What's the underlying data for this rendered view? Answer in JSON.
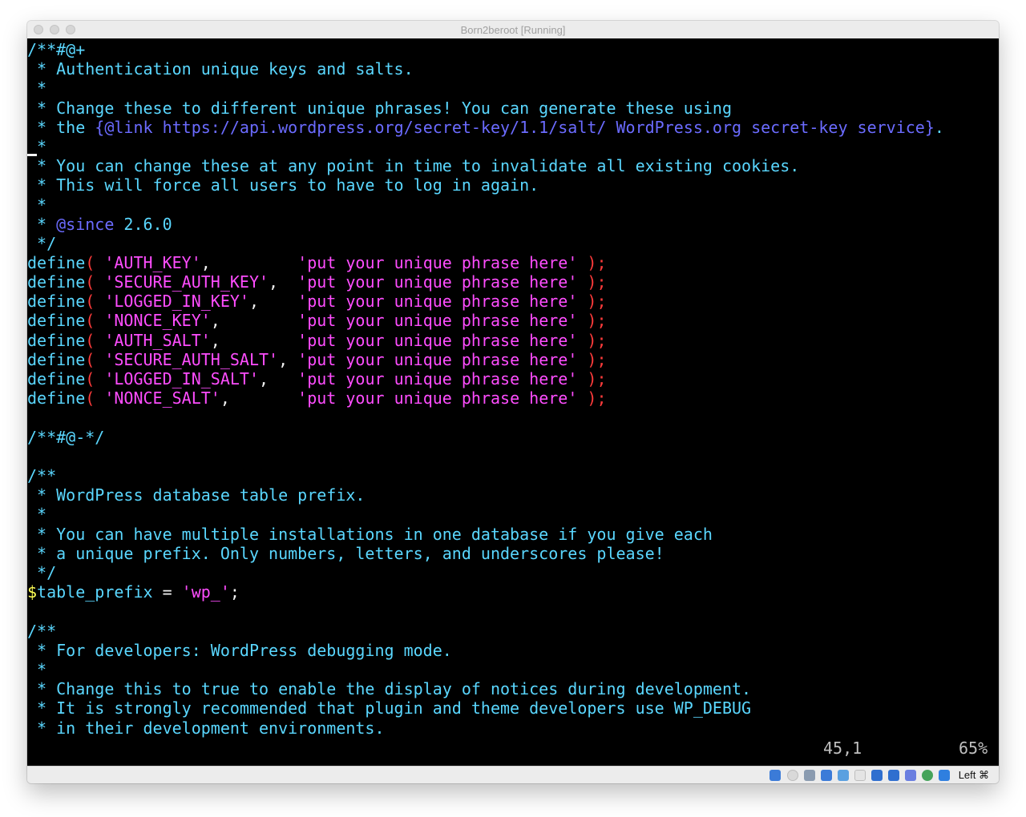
{
  "window": {
    "title": "Born2beroot [Running]"
  },
  "editor": {
    "lines": {
      "l01": "/**#@+",
      "l02": " * Authentication unique keys and salts.",
      "l03": " *",
      "l04": " * Change these to different unique phrases! You can generate these using",
      "l05_a": " * the ",
      "l05_b": "{@link https://api.wordpress.org/secret-key/1.1/salt/ WordPress.org secret-key service}",
      "l05_c": ".",
      "l06": "*",
      "l07": " * You can change these at any point in time to invalidate all existing cookies.",
      "l08": " * This will force all users to have to log in again.",
      "l09": " *",
      "l10_a": " * ",
      "l10_b": "@since",
      "l10_c": " 2.6.0",
      "l11": " */",
      "l13": "/**#@-*/",
      "l15": "/**",
      "l16": " * WordPress database table prefix.",
      "l17": " *",
      "l18": " * You can have multiple installations in one database if you give each",
      "l19": " * a unique prefix. Only numbers, letters, and underscores please!",
      "l20": " */",
      "l22": "/**",
      "l23": " * For developers: WordPress debugging mode.",
      "l24": " *",
      "l25": " * Change this to true to enable the display of notices during development.",
      "l26": " * It is strongly recommended that plugin and theme developers use WP_DEBUG",
      "l27": " * in their development environments."
    },
    "defines": [
      {
        "keyword": "define",
        "open": "( ",
        "key": "'AUTH_KEY'",
        "sep": ",         ",
        "value": "'put your unique phrase here'",
        "close": " );"
      },
      {
        "keyword": "define",
        "open": "( ",
        "key": "'SECURE_AUTH_KEY'",
        "sep": ",  ",
        "value": "'put your unique phrase here'",
        "close": " );"
      },
      {
        "keyword": "define",
        "open": "( ",
        "key": "'LOGGED_IN_KEY'",
        "sep": ",    ",
        "value": "'put your unique phrase here'",
        "close": " );"
      },
      {
        "keyword": "define",
        "open": "( ",
        "key": "'NONCE_KEY'",
        "sep": ",        ",
        "value": "'put your unique phrase here'",
        "close": " );"
      },
      {
        "keyword": "define",
        "open": "( ",
        "key": "'AUTH_SALT'",
        "sep": ",        ",
        "value": "'put your unique phrase here'",
        "close": " );"
      },
      {
        "keyword": "define",
        "open": "( ",
        "key": "'SECURE_AUTH_SALT'",
        "sep": ", ",
        "value": "'put your unique phrase here'",
        "close": " );"
      },
      {
        "keyword": "define",
        "open": "( ",
        "key": "'LOGGED_IN_SALT'",
        "sep": ",   ",
        "value": "'put your unique phrase here'",
        "close": " );"
      },
      {
        "keyword": "define",
        "open": "( ",
        "key": "'NONCE_SALT'",
        "sep": ",       ",
        "value": "'put your unique phrase here'",
        "close": " );"
      }
    ],
    "prefix_line": {
      "dollar": "$",
      "name": "table_prefix",
      "eq": " = ",
      "value": "'wp_'",
      "end": ";"
    },
    "status": {
      "position": "45,1",
      "percent": "65%"
    }
  },
  "vbox_statusbar": {
    "icons": [
      "hard-disk-icon",
      "optical-disk-icon",
      "audio-icon",
      "network-icon",
      "usb-icon",
      "shared-folders-icon",
      "display-icon",
      "recording-icon",
      "cpu-icon",
      "guest-additions-icon",
      "mouse-integration-icon",
      "keyboard-capture-icon"
    ],
    "host_key": "Left ⌘"
  },
  "colors": {
    "comment": "#5ad7ff",
    "string": "#ff4dff",
    "paren": "#ff3b3b",
    "doc_tag": "#6b6bff",
    "variable": "#ffff55",
    "background": "#000000"
  }
}
